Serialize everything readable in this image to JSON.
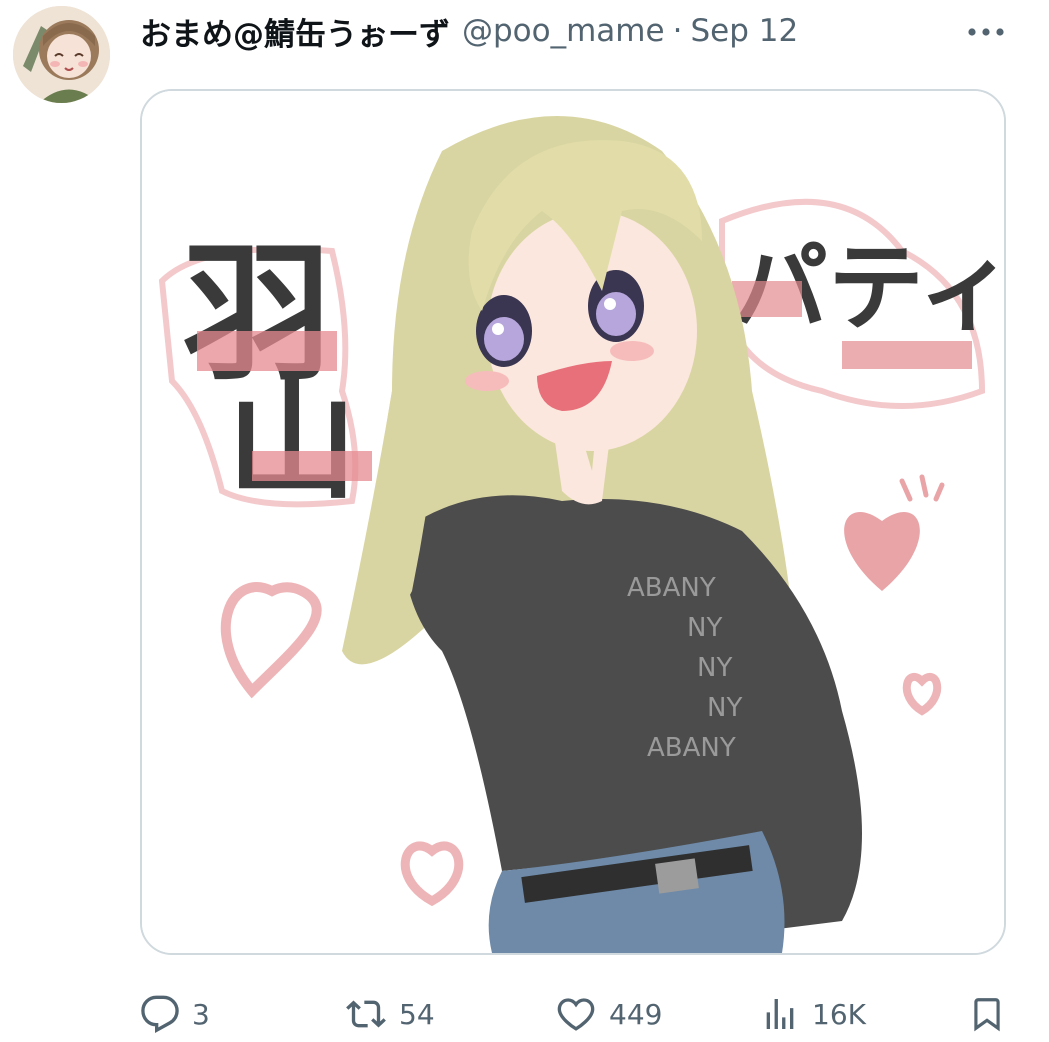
{
  "tweet": {
    "display_name": "おまめ@鯖缶うぉーず",
    "handle": "@poo_mame",
    "separator": "·",
    "time": "Sep 12"
  },
  "media": {
    "text_left": [
      "羽",
      "山"
    ],
    "text_right": "パティ",
    "shirt_text": [
      "ABANY",
      "NY",
      "NY",
      "NY",
      "ABANY"
    ]
  },
  "actions": {
    "reply_count": "3",
    "retweet_count": "54",
    "like_count": "449",
    "views_count": "16K"
  },
  "icons": {
    "more": "more-horizontal-icon",
    "reply": "reply-icon",
    "retweet": "retweet-icon",
    "like": "heart-icon",
    "views": "bar-chart-icon",
    "bookmark": "bookmark-icon"
  },
  "colors": {
    "secondary_text": "#536471",
    "border": "#cfd9de",
    "hair": "#d8d4a0",
    "sweater": "#4a4a4a",
    "pink": "#e48a8f"
  }
}
